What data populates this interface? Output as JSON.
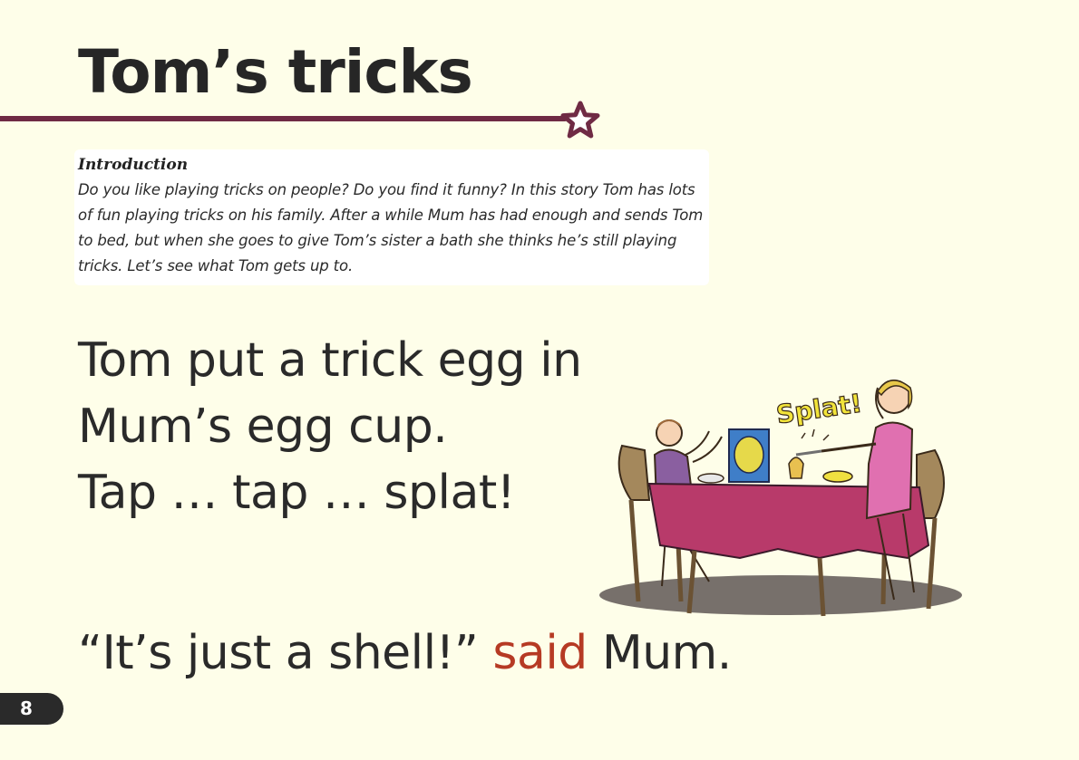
{
  "page": {
    "title": "Tom’s tricks",
    "page_number": "8"
  },
  "introduction": {
    "heading": "Introduction",
    "text": "Do you like playing tricks on people? Do you find it funny? In this story Tom has lots of fun playing tricks on his family. After a while Mum has had enough and sends Tom to bed, but when she goes to give Tom’s sister a bath she thinks he’s still playing tricks. Let’s see what Tom gets up to."
  },
  "story": {
    "lines": [
      "Tom put a trick egg in",
      "Mum’s egg cup.",
      "Tap … tap … splat!"
    ],
    "dialogue": {
      "quote": "“It’s just a shell!”",
      "said_word": "said",
      "speaker": "Mum."
    }
  },
  "illustration": {
    "sound_effect": "Splat!"
  },
  "colors": {
    "background": "#fefee9",
    "rule": "#6f2a44",
    "said_word": "#b63a24",
    "page_tab": "#2a2a2a"
  },
  "icons": {
    "title_rule_end": "star-icon"
  }
}
